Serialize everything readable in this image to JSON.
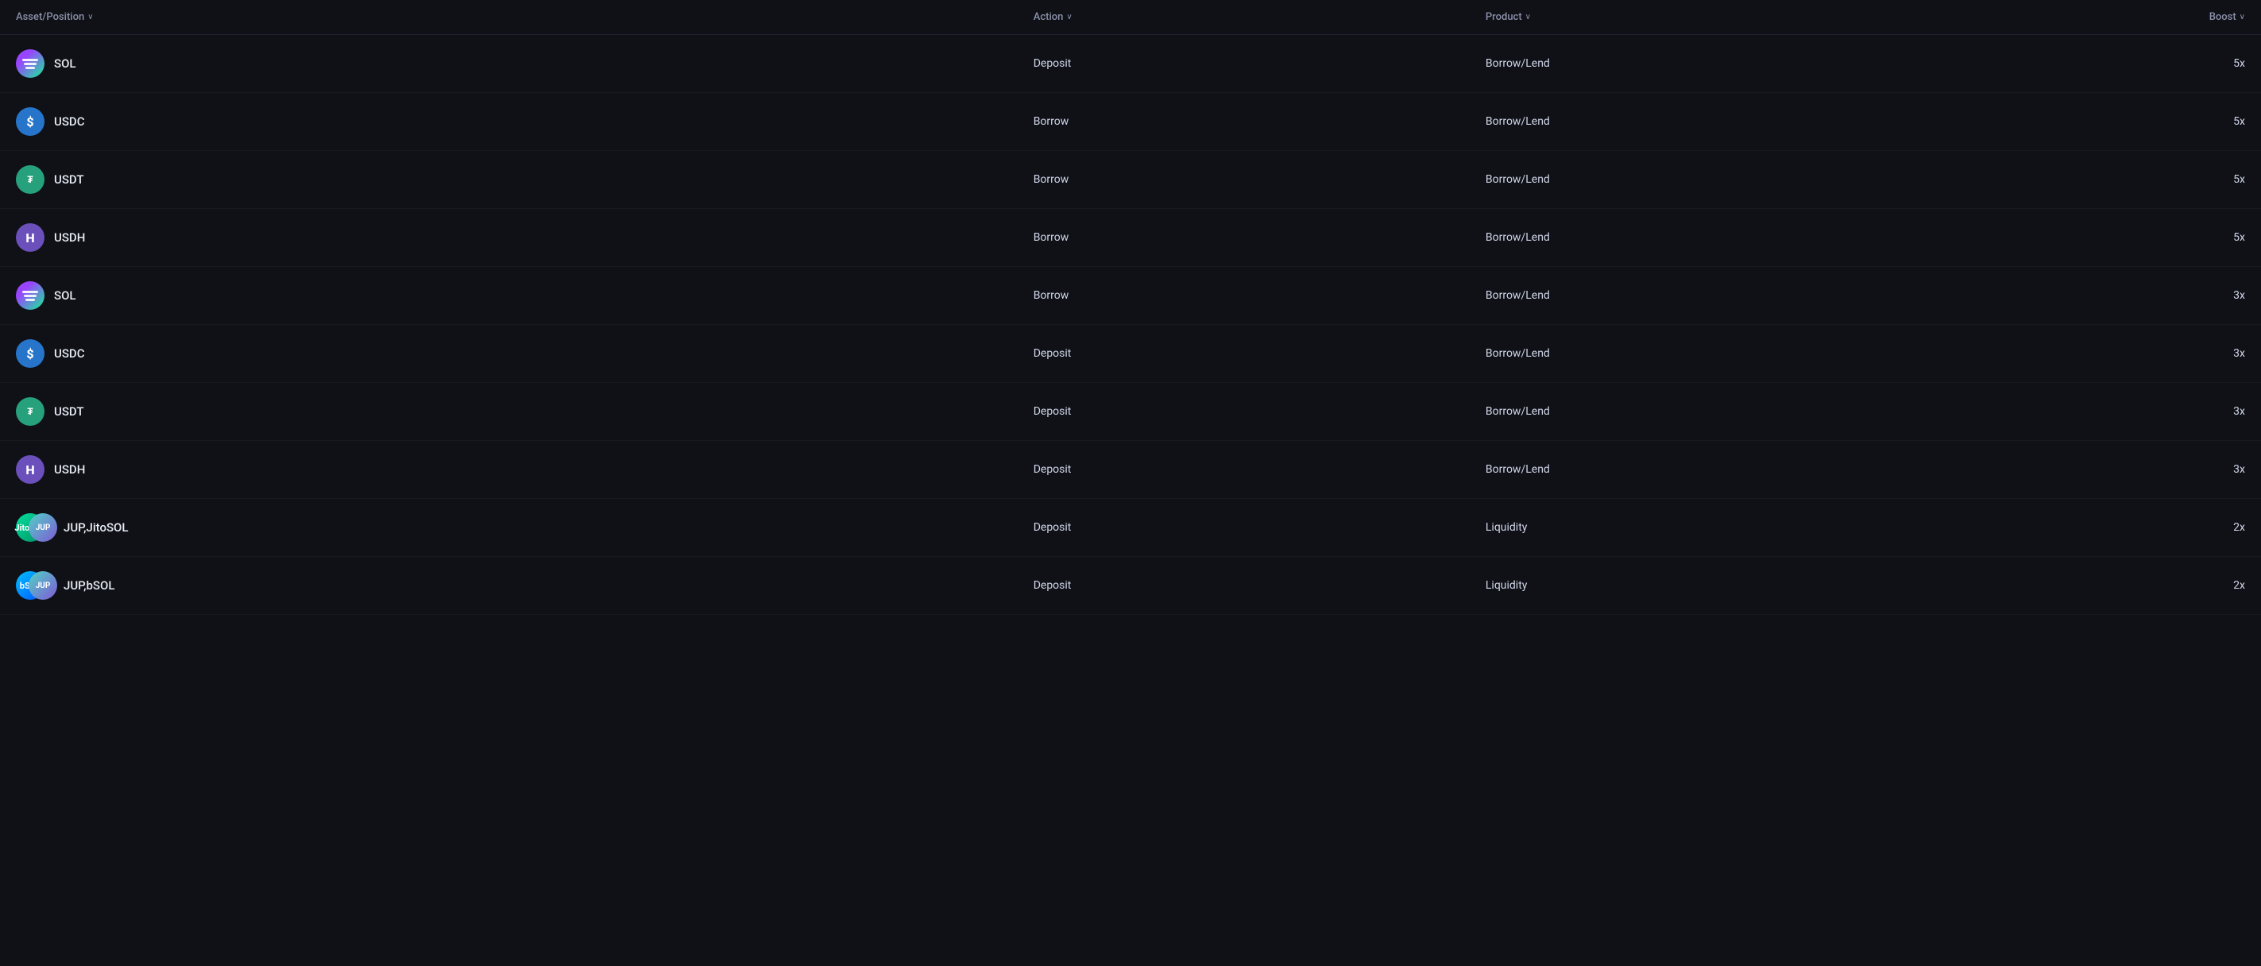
{
  "columns": {
    "asset": "Asset/Position",
    "action": "Action",
    "product": "Product",
    "boost": "Boost"
  },
  "rows": [
    {
      "id": 1,
      "asset": "SOL",
      "assetType": "single",
      "iconType": "sol",
      "action": "Deposit",
      "product": "Borrow/Lend",
      "boost": "5x"
    },
    {
      "id": 2,
      "asset": "USDC",
      "assetType": "single",
      "iconType": "usdc",
      "action": "Borrow",
      "product": "Borrow/Lend",
      "boost": "5x"
    },
    {
      "id": 3,
      "asset": "USDT",
      "assetType": "single",
      "iconType": "usdt",
      "action": "Borrow",
      "product": "Borrow/Lend",
      "boost": "5x"
    },
    {
      "id": 4,
      "asset": "USDH",
      "assetType": "single",
      "iconType": "usdh",
      "action": "Borrow",
      "product": "Borrow/Lend",
      "boost": "5x"
    },
    {
      "id": 5,
      "asset": "SOL",
      "assetType": "single",
      "iconType": "sol",
      "action": "Borrow",
      "product": "Borrow/Lend",
      "boost": "3x"
    },
    {
      "id": 6,
      "asset": "USDC",
      "assetType": "single",
      "iconType": "usdc",
      "action": "Deposit",
      "product": "Borrow/Lend",
      "boost": "3x"
    },
    {
      "id": 7,
      "asset": "USDT",
      "assetType": "single",
      "iconType": "usdt",
      "action": "Deposit",
      "product": "Borrow/Lend",
      "boost": "3x"
    },
    {
      "id": 8,
      "asset": "USDH",
      "assetType": "single",
      "iconType": "usdh",
      "action": "Deposit",
      "product": "Borrow/Lend",
      "boost": "3x"
    },
    {
      "id": 9,
      "asset": "JUP,JitoSOL",
      "assetType": "pair",
      "iconType": "jup-jitosol",
      "action": "Deposit",
      "product": "Liquidity",
      "boost": "2x"
    },
    {
      "id": 10,
      "asset": "JUP,bSOL",
      "assetType": "pair",
      "iconType": "jup-bsol",
      "action": "Deposit",
      "product": "Liquidity",
      "boost": "2x"
    }
  ],
  "colors": {
    "bg": "#0f1117",
    "headerText": "#8a8fa8",
    "rowBorder": "#161921",
    "rowHover": "#161b28",
    "text": "#d0d5e8",
    "assetName": "#e8ecf4"
  }
}
